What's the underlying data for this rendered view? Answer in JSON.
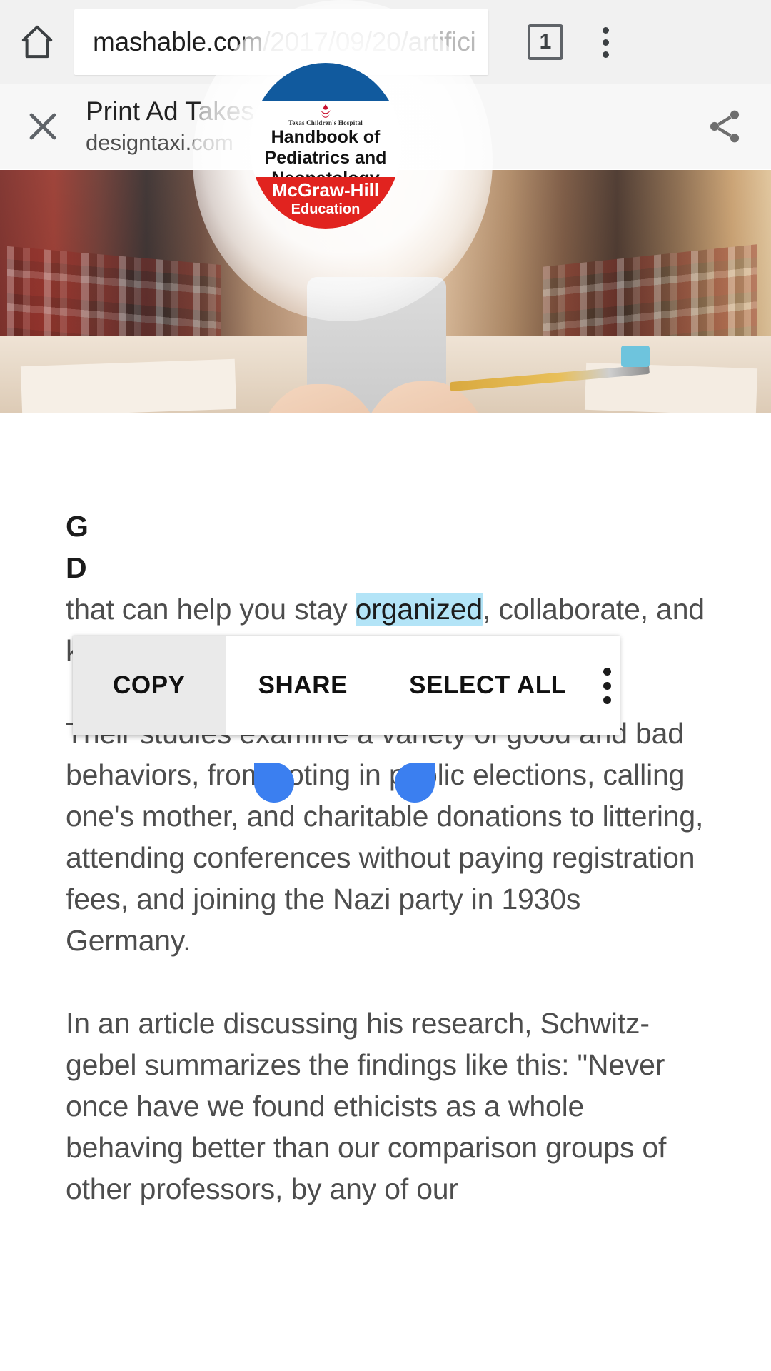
{
  "browser": {
    "home_icon": "home-icon",
    "url_host": "mashable.com",
    "url_path": "/2017/09/20/artifici",
    "tab_count": "1",
    "overflow_icon": "chrome-overflow-icon"
  },
  "amp_bar": {
    "close_icon": "close-icon",
    "title": "Print Ad Takes T",
    "title_tail": "e…",
    "source": "designtaxi.com",
    "share_icon": "share-icon"
  },
  "ad": {
    "hospital_name": "Texas Children's Hospital",
    "flame_icon": "flame-logo-icon",
    "book_line1": "Handbook of",
    "book_line2": "Pediatrics and",
    "book_line3": "Neonatology",
    "publisher": "McGraw-Hill",
    "publisher_sub": "Education",
    "blue": "#115a9e",
    "red": "#e1231f"
  },
  "selection_menu": {
    "copy": "COPY",
    "share": "SHARE",
    "select_all": "SELECT ALL",
    "overflow_icon": "menu-overflow-icon",
    "handle_left_icon": "selection-handle-left-icon",
    "handle_right_icon": "selection-handle-right-icon",
    "handle_color": "#3b7ff0",
    "highlight_color": "#b3e4f7"
  },
  "article": {
    "headline_line1": "G",
    "headline_line2": "D",
    "selected_para_pre": "that can help you stay ",
    "selected_word": "organized",
    "selected_para_post": ", collaborate, and keep your account secure.",
    "paragraph_2": "Their studies examine a variety of good and bad behaviors, from voting in public elections, calling one's mother, and charitable donations to littering, attending conferences without paying registration fees, and joining the Nazi party in 1930s Germany.",
    "paragraph_3": "In an article discussing his research, Schwitz-gebel summarizes the findings like this: \"Never once have we found ethicists as a whole behaving better than our comparison groups of other professors, by any of our"
  }
}
